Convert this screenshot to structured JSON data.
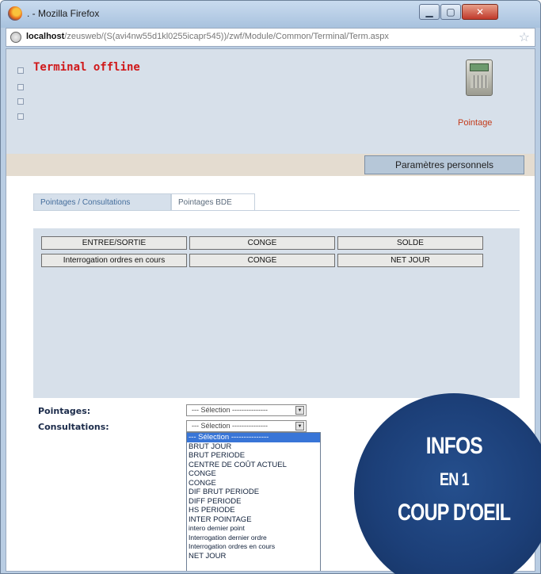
{
  "window": {
    "title": ". - Mozilla Firefox",
    "url_host": "localhost",
    "url_path": "/zeusweb/(S(avi4nw55d1kl0255icapr545))/zwf/Module/Common/Terminal/Term.aspx",
    "buttons": [
      "minimize",
      "maximize",
      "close"
    ]
  },
  "header": {
    "status": "Terminal offline",
    "terminal_label": "Pointage",
    "settings_button": "Paramètres personnels"
  },
  "tabs": [
    {
      "label": "Pointages / Consultations",
      "active": true
    },
    {
      "label": "Pointages BDE",
      "active": false
    }
  ],
  "panel": {
    "buttons": [
      [
        "ENTREE/SORTIE",
        "CONGE",
        "SOLDE"
      ],
      [
        "Interrogation ordres en cours",
        "CONGE",
        "NET JOUR"
      ]
    ]
  },
  "form": {
    "pointages_label": "Pointages:",
    "consultations_label": "Consultations:",
    "pointages_value": "--- Sélection ---------------",
    "consultations_value": "--- Sélection ---------------"
  },
  "dropdown": {
    "options": [
      "--- Sélection ---------------",
      "BRUT JOUR",
      "BRUT PERIODE",
      "CENTRE DE COÛT ACTUEL",
      "CONGE",
      "CONGE",
      "DIF BRUT PERIODE",
      "DIFF PERIODE",
      "HS PERIODE",
      "INTER POINTAGE",
      "intero dernier point",
      "Interrogation dernier ordre",
      "Interrogation ordres en cours",
      "NET JOUR"
    ],
    "selected_index": 0
  },
  "promo": {
    "line1": "INFOS",
    "line2": "EN 1",
    "line3": "COUP D'OEIL",
    "color": "#1c3f78"
  },
  "colors": {
    "status_red": "#d0181a",
    "header_bg": "#d7e0ea",
    "dropdown_highlight": "#3875d7"
  }
}
